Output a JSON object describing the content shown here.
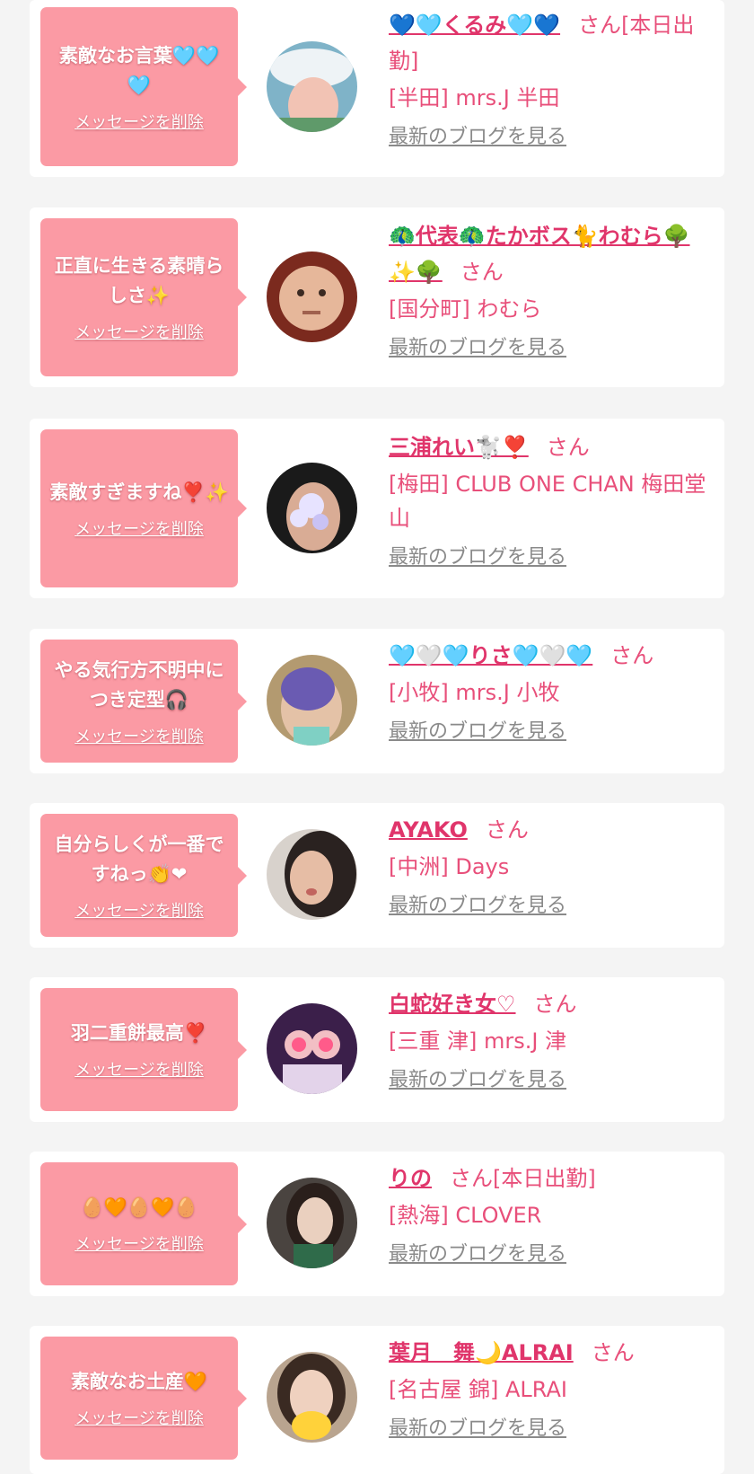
{
  "delete_label": "メッセージを削除",
  "blog_label": "最新のブログを見る",
  "honorific": "さん",
  "colors": {
    "bubble": "#fb9aa4",
    "accent": "#e84f7a",
    "link_gray": "#8a8a8a",
    "background": "#f4f4f4"
  },
  "items": [
    {
      "message": "素敵なお言葉🩵🩵🩵",
      "name": "💙🩵くるみ🩵💙",
      "suffix": "[本日出勤]",
      "shop": "[半田] mrs.J 半田"
    },
    {
      "message": "正直に生きる素晴らしさ✨",
      "name": "🦚代表🦚たかボス🐈わむら🌳✨🌳",
      "suffix": "",
      "shop": "[国分町] わむら"
    },
    {
      "message": "素敵すぎますね❣️✨",
      "name": "三浦れい🐩❣️",
      "suffix": "",
      "shop": "[梅田] CLUB ONE CHAN 梅田堂山"
    },
    {
      "message": "やる気行方不明中につき定型🎧",
      "name": "🩵🤍🩵りさ🩵🤍🩵",
      "suffix": "",
      "shop": "[小牧] mrs.J 小牧"
    },
    {
      "message": "自分らしくが一番ですねっ👏❤",
      "name": "AYAKO",
      "suffix": "",
      "shop": "[中洲] Days"
    },
    {
      "message": "羽二重餅最高❣️",
      "name": "白蛇好き女♡",
      "suffix": "",
      "shop": "[三重 津] mrs.J 津"
    },
    {
      "message": "🥚🧡🥚🧡🥚",
      "name": "りの",
      "suffix": "[本日出勤]",
      "shop": "[熱海] CLOVER"
    },
    {
      "message": "素敵なお土産🧡",
      "name": "葉月　舞🌙ALRAI",
      "suffix": "",
      "shop": "[名古屋 錦] ALRAI"
    }
  ]
}
